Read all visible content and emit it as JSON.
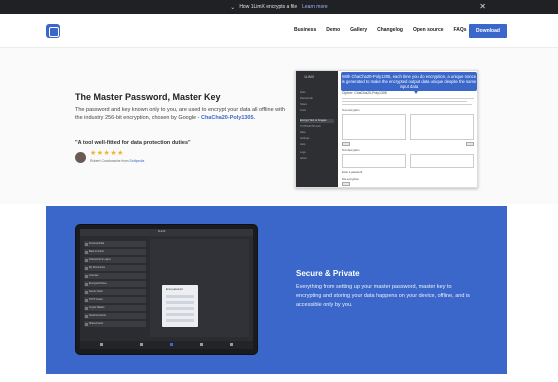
{
  "banner": {
    "text": "How 1LimX encrypts a file",
    "learn_more": "Learn more",
    "close_icon": "close-icon"
  },
  "nav": {
    "items": [
      "Business",
      "Demo",
      "Gallery",
      "Changelog",
      "Open source",
      "FAQs"
    ],
    "download": "Download"
  },
  "hero": {
    "heading": "The Master Password, Master Key",
    "desc_prefix": "The password and key known only to you, are used to encrypt your data all offline with the industry 256-bit encryption, chosen by Google - ",
    "desc_link": "ChaCha20-Poly1305.",
    "quote": "\"A tool well-fitted for data protection duties\"",
    "stars": "★★★★★",
    "reviewer_prefix": "Robert Condorache from ",
    "reviewer_link": "Softpedia"
  },
  "screenshot1": {
    "tooltip": "With ChaCha20-Poly1305, each time you do encryption, a unique nonce is generated to make the encrypted output data unique despite the same input data",
    "sidebar_brand": "1LIMX",
    "sidebar_items": [
      "Files",
      "Passwords",
      "Notes",
      "Tools",
      "Encrypt Text or Images",
      "TOTP/HOTP Auth",
      "Data",
      "Settings",
      "Help",
      "Logs",
      "About"
    ],
    "panel_title": "Cipher: ChaCha20-Poly1305",
    "labels": [
      "Text encryption",
      "Text decryption",
      "Enter a password",
      "File encryption"
    ],
    "buttons": [
      "Clear",
      "Copy",
      "Clear",
      "Copy"
    ]
  },
  "secure": {
    "heading": "Secure & Private",
    "desc": "Everything from setting up your master password, master key to encrypting and storing your data happens on your device, offline, and is accessible only by you."
  },
  "tablet": {
    "title": "1LimX",
    "list_items": [
      "Personal Data",
      "Bank & Cards",
      "Passwords & Logins",
      "My Documents",
      "Licenses",
      "Encrypted Notes",
      "Secure Vault",
      "TOTP Codes",
      "Crypto Wallets",
      "Social Accounts",
      "Shared Items"
    ],
    "dialog_title": "Enter password"
  },
  "colors": {
    "accent": "#3a67c9",
    "banner_bg": "#202124",
    "stars": "#f0b429"
  }
}
